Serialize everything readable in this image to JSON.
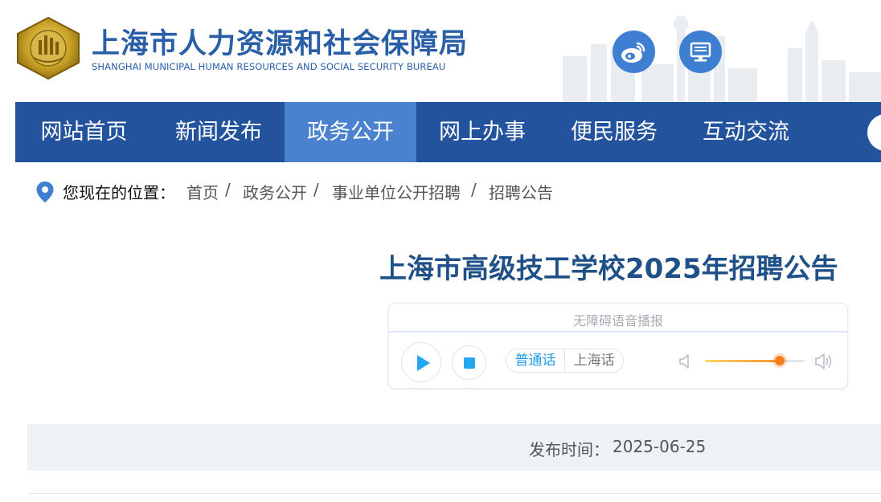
{
  "header": {
    "title": "上海市人力资源和社会保障局",
    "subtitle": "SHANGHAI MUNICIPAL HUMAN RESOURCES AND SOCIAL SECURITY BUREAU",
    "icons": [
      "emblem-logo",
      "weibo-icon",
      "desktop-icon"
    ]
  },
  "nav": {
    "items": [
      {
        "label": "网站首页"
      },
      {
        "label": "新闻发布"
      },
      {
        "label": "政务公开"
      },
      {
        "label": "网上办事"
      },
      {
        "label": "便民服务"
      },
      {
        "label": "互动交流"
      }
    ],
    "active_index": 2
  },
  "breadcrumb": {
    "prefix": "您现在的位置：",
    "items": [
      "首页",
      "政务公开",
      "事业单位公开招聘",
      "招聘公告"
    ],
    "separator": "/"
  },
  "article": {
    "title": "上海市高级技工学校2025年招聘公告",
    "publish_label": "发布时间：",
    "publish_date": "2025-06-25"
  },
  "player": {
    "title": "无障碍语音播报",
    "languages": [
      "普通话",
      "上海话"
    ],
    "selected_language": "普通话",
    "volume_fraction": 0.75
  },
  "colors": {
    "brand_blue": "#2a5fa8",
    "nav_bg": "#24539d",
    "nav_active": "#4a82d0",
    "title_blue": "#1f5188",
    "player_accent": "#1f9be8",
    "volume_orange": "#f57d20"
  }
}
